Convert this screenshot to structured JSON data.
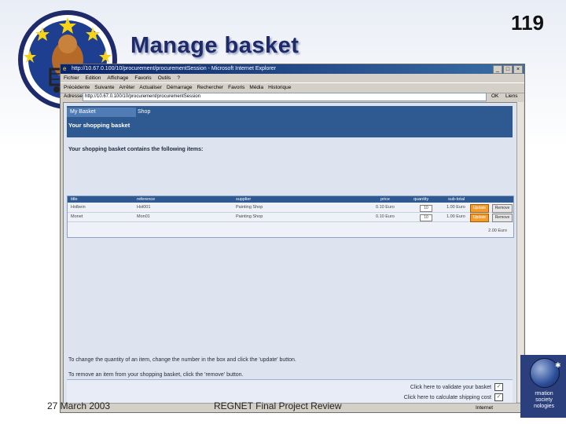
{
  "slide": {
    "number": "119",
    "title": "Manage basket",
    "footer_date": "27 March 2003",
    "footer_title": "REGNET Final Project Review"
  },
  "right_badge": {
    "text_line1": "rmation",
    "text_line2": "society",
    "text_line3": "nologies"
  },
  "browser": {
    "window_title": "http://10.67.0.100/10/procurement/procurementSession - Microsoft Internet Explorer",
    "menu": [
      "Fichier",
      "Edition",
      "Affichage",
      "Favoris",
      "Outils",
      "?"
    ],
    "toolbar": [
      "Précédente",
      "Suivante",
      "Arrêter",
      "Actualiser",
      "Démarrage",
      "Rechercher",
      "Favoris",
      "Média",
      "Historique"
    ],
    "address_label": "Adresse",
    "address_value": "http://10.67.0.100/10/procurement/procurementSession",
    "go_label": "OK",
    "links_label": "Liens",
    "status_zone": "Internet"
  },
  "page": {
    "tabs": [
      "My Basket",
      "Shop"
    ],
    "heading": "Your shopping basket",
    "intro": "Your shopping basket contains the following items:",
    "table": {
      "columns": [
        "title",
        "reference",
        "supplier",
        "price",
        "quantity",
        "sub-total"
      ],
      "rows": [
        {
          "title": "Holbein",
          "reference": "Hol001",
          "supplier": "Painting Shop",
          "price": "0.10 Euro",
          "quantity": "10",
          "subtotal": "1.00 Euro",
          "update": "Update",
          "remove": "Remove"
        },
        {
          "title": "Monet",
          "reference": "Mon01",
          "supplier": "Painting Shop",
          "price": "0.10 Euro",
          "quantity": "10",
          "subtotal": "1.00 Euro",
          "update": "Update",
          "remove": "Remove"
        }
      ],
      "total": "2.00 Euro"
    },
    "instruction_quantity": "To change the quantity of an item, change the number in the box and click the 'update' button.",
    "instruction_remove": "To remove an item from your shopping basket, click the 'remove' button.",
    "validate_link": "Click here to validate your basket",
    "shipping_link": "Click here to calculate shipping cost"
  }
}
